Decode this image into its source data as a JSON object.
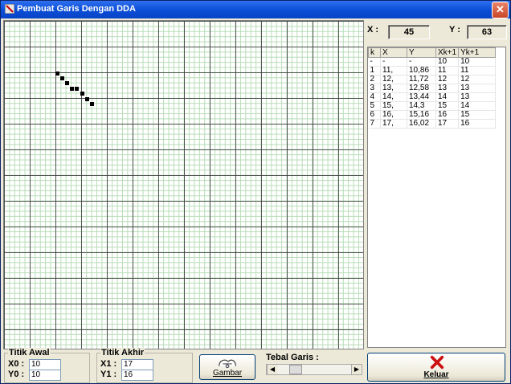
{
  "window": {
    "title": "Pembuat Garis Dengan DDA",
    "close_glyph": "✕"
  },
  "coords": {
    "x_label": "X :",
    "x_value": "45",
    "y_label": "Y :",
    "y_value": "63"
  },
  "table": {
    "headers": [
      "k",
      "X",
      "Y",
      "Xk+1",
      "Yk+1"
    ],
    "rows": [
      [
        "-",
        "-",
        "-",
        "10",
        "10"
      ],
      [
        "1",
        "11,",
        "10,86",
        "11",
        "11"
      ],
      [
        "2",
        "12,",
        "11,72",
        "12",
        "12"
      ],
      [
        "3",
        "13,",
        "12,58",
        "13",
        "13"
      ],
      [
        "4",
        "14,",
        "13,44",
        "14",
        "13"
      ],
      [
        "5",
        "15,",
        "14,3",
        "15",
        "14"
      ],
      [
        "6",
        "16,",
        "15,16",
        "16",
        "15"
      ],
      [
        "7",
        "17,",
        "16,02",
        "17",
        "16"
      ]
    ]
  },
  "titik_awal": {
    "label": "Titik Awal",
    "x0_label": "X0 :",
    "x0_value": "10",
    "y0_label": "Y0 :",
    "y0_value": "10"
  },
  "titik_akhir": {
    "label": "Titik Akhir",
    "x1_label": "X1 :",
    "x1_value": "17",
    "y1_label": "Y1 :",
    "y1_value": "16"
  },
  "gambar_button": {
    "label": "Gambar",
    "icon": "drawing-hands-icon"
  },
  "tebal_garis": {
    "label": "Tebal Garis :",
    "level": 0.2
  },
  "keluar_button": {
    "label": "Keluar",
    "icon": "red-x-icon"
  },
  "colors": {
    "titlebar": "#0a4ed6",
    "grid_major": "#3c3c3c",
    "grid_minor": "#b8dcb8",
    "exit_red": "#cc1010"
  }
}
